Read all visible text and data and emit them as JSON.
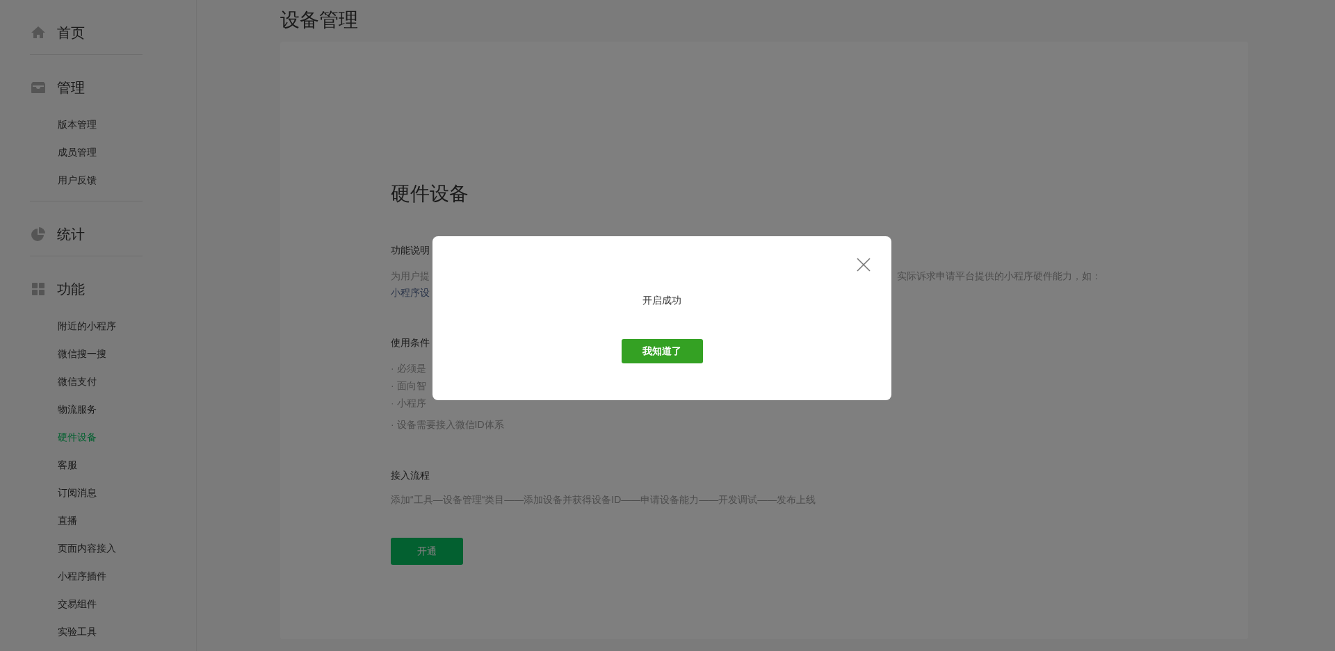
{
  "sidebar": {
    "groups": [
      {
        "label": "首页",
        "kind": "home"
      },
      {
        "label": "管理",
        "kind": "inbox",
        "items": [
          {
            "label": "版本管理",
            "selected": false
          },
          {
            "label": "成员管理",
            "selected": false
          },
          {
            "label": "用户反馈",
            "selected": false
          }
        ]
      },
      {
        "label": "统计",
        "kind": "pie"
      },
      {
        "label": "功能",
        "kind": "grid",
        "items": [
          {
            "label": "附近的小程序",
            "selected": false
          },
          {
            "label": "微信搜一搜",
            "selected": false
          },
          {
            "label": "微信支付",
            "selected": false
          },
          {
            "label": "物流服务",
            "selected": false
          },
          {
            "label": "硬件设备",
            "selected": true
          },
          {
            "label": "客服",
            "selected": false
          },
          {
            "label": "订阅消息",
            "selected": false
          },
          {
            "label": "直播",
            "selected": false
          },
          {
            "label": "页面内容接入",
            "selected": false
          },
          {
            "label": "小程序插件",
            "selected": false
          },
          {
            "label": "交易组件",
            "selected": false
          },
          {
            "label": "实验工具",
            "selected": false
          }
        ]
      }
    ]
  },
  "page_title": "设备管理",
  "section": {
    "title": "硬件设备",
    "feature_description": {
      "heading": "功能说明",
      "line_1_left": "为用户提",
      "line_1_right": "实际诉求申请平台提供的小程序硬件能力，如：",
      "line_2_link": "小程序设"
    },
    "conditions": {
      "heading": "使用条件",
      "items": [
        "· 必须是",
        "· 面向智",
        "· 小程序",
        "· 设备需要接入微信ID体系"
      ]
    },
    "process": {
      "heading": "接入流程",
      "text": "添加“工具—设备管理“类目——添加设备并获得设备ID——申请设备能力——开发调试——发布上线"
    },
    "open_button": "开通"
  },
  "dialog": {
    "message": "开启成功",
    "confirm_button": "我知道了"
  }
}
